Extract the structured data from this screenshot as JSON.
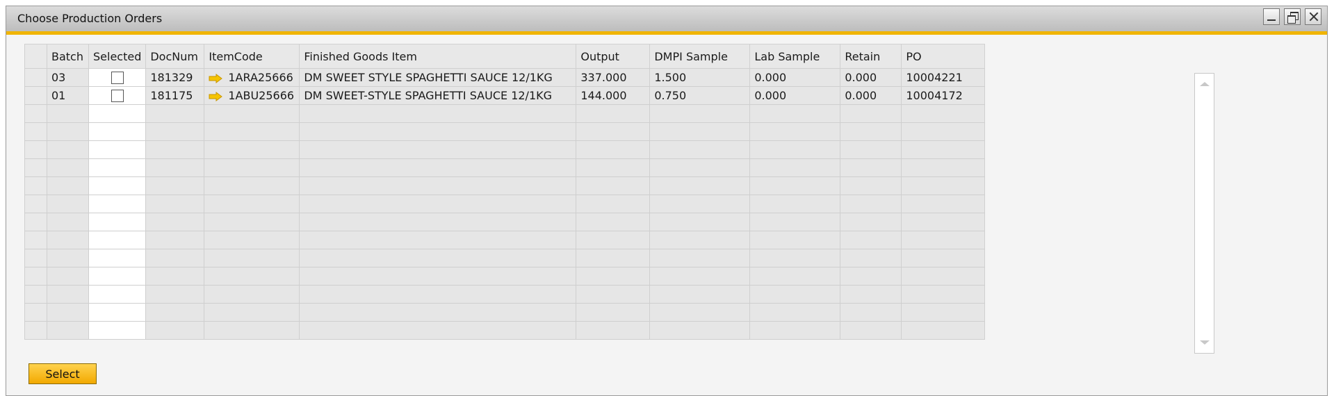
{
  "window": {
    "title": "Choose Production Orders"
  },
  "table": {
    "columns": [
      "",
      "Batch",
      "Selected",
      "DocNum",
      "ItemCode",
      "Finished Goods Item",
      "Output",
      "DMPI Sample",
      "Lab Sample",
      "Retain",
      "PO"
    ],
    "rows": [
      {
        "batch": "03",
        "selected": false,
        "docnum": "181329",
        "itemcode": "1ARA25666",
        "item": "DM SWEET STYLE SPAGHETTI SAUCE 12/1KG",
        "output": "337.000",
        "dmpi": "1.500",
        "lab": "0.000",
        "retain": "0.000",
        "po": "10004221"
      },
      {
        "batch": "01",
        "selected": false,
        "docnum": "181175",
        "itemcode": "1ABU25666",
        "item": "DM SWEET-STYLE SPAGHETTI SAUCE 12/1KG",
        "output": "144.000",
        "dmpi": "0.750",
        "lab": "0.000",
        "retain": "0.000",
        "po": "10004172"
      }
    ]
  },
  "buttons": {
    "select_label": "Select"
  },
  "icons": {
    "link_arrow": "link-arrow-icon",
    "minimize": "minimize-icon",
    "restore": "restore-icon",
    "close": "close-icon"
  },
  "colors": {
    "accent": "#f0b400",
    "button": "#ffc933",
    "arrow": "#f5c400"
  }
}
